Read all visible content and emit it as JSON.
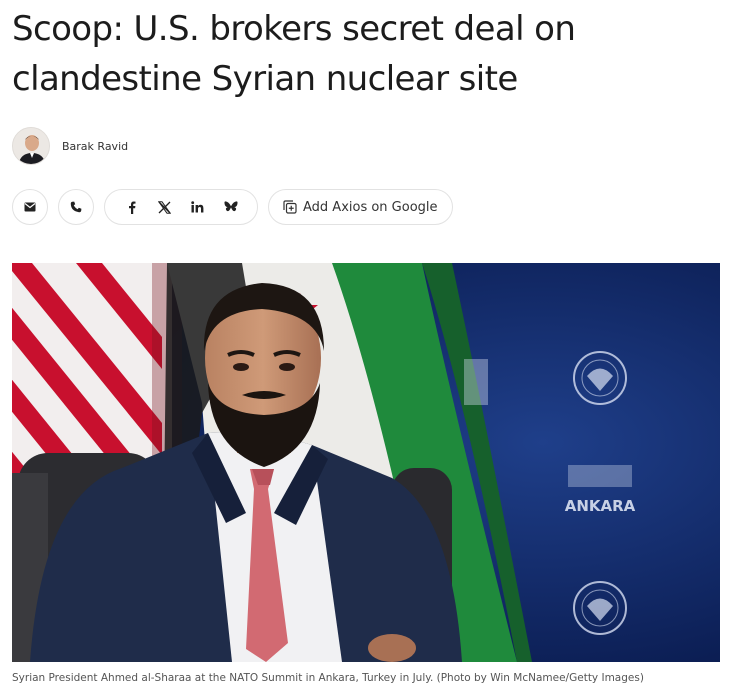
{
  "article": {
    "headline": "Scoop: U.S. brokers secret deal on clandestine Syrian nuclear site",
    "author": "Barak Ravid",
    "share": {
      "email_icon": "mail-icon",
      "phone_icon": "phone-icon",
      "social_icons": [
        "facebook-icon",
        "x-icon",
        "linkedin-icon",
        "bluesky-icon"
      ],
      "google_label": "Add Axios on Google",
      "google_icon": "add-source-icon"
    },
    "photo": {
      "podium_text": "ANKARA"
    },
    "caption": "Syrian President Ahmed al-Sharaa at the NATO Summit in Ankara, Turkey in July. (Photo by Win McNamee/Getty Images)"
  },
  "colors": {
    "flag_red": "#c8102e",
    "flag_green": "#1f8a3c",
    "backdrop_blue": "#102a66",
    "tie": "#d26a72",
    "suit": "#1f2c4a"
  }
}
